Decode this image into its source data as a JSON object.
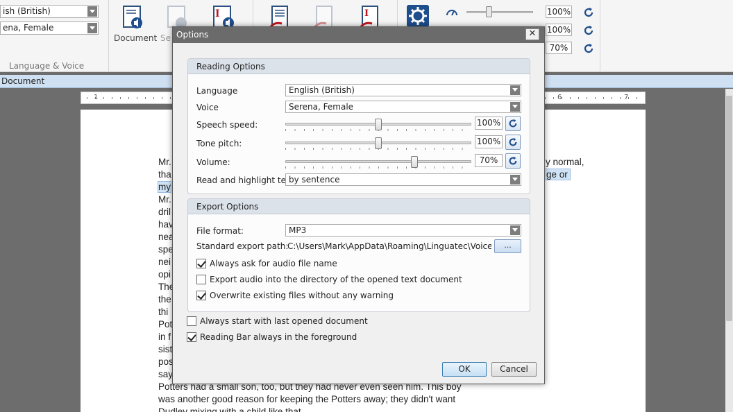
{
  "ribbon": {
    "language_value": "ish (British)",
    "voice_value": "ena, Female",
    "group_language_voice": "Language & Voice",
    "document_button": "Document",
    "second_button_partial": "Se",
    "speed_value": "100%",
    "pitch_value": "100%",
    "volume_value": "70%"
  },
  "doc_tab": "Document",
  "ruler": {
    "left_num": "1",
    "right_num1": "6",
    "right_num2": "7"
  },
  "document": {
    "lines_left": [
      "Mr.",
      "tha",
      "my",
      "Mr.",
      "dril",
      "hav",
      "nea",
      "spe",
      "nei",
      "opi",
      "The",
      "the",
      "thi",
      "Pot",
      "in f",
      "sist",
      "pos",
      "say"
    ],
    "line_right_1": "y normal,",
    "line_right_2": "ge or",
    "bottom_line_1": "Potters had a small son, too, but they had never even seen him. This boy",
    "bottom_line_2": "was another good reason for keeping the Potters away; they didn't want",
    "bottom_line_3": "Dudley mixing with a child like that."
  },
  "dialog": {
    "title": "Options",
    "close_label": "✕",
    "reading": {
      "header": "Reading Options",
      "language_label": "Language",
      "language_value": "English (British)",
      "voice_label": "Voice",
      "voice_value": "Serena, Female",
      "speed_label": "Speech speed:",
      "speed_value": "100%",
      "speed_level": 0.5,
      "pitch_label": "Tone pitch:",
      "pitch_value": "100%",
      "pitch_level": 0.5,
      "volume_label": "Volume:",
      "volume_value": "70%",
      "volume_level": 0.7,
      "highlight_label": "Read and highlight text",
      "highlight_value": "by sentence"
    },
    "export": {
      "header": "Export Options",
      "format_label": "File format:",
      "format_value": "MP3",
      "path_label": "Standard export path:",
      "path_value": "C:\\Users\\Mark\\AppData\\Roaming\\Linguatec\\VoiceRe...",
      "browse_label": "...",
      "ask_name_label": "Always ask for audio file name",
      "ask_name_checked": true,
      "export_dir_label": "Export audio into the directory of the opened text document",
      "export_dir_checked": false,
      "overwrite_label": "Overwrite existing files without any warning",
      "overwrite_checked": true
    },
    "start_last_label": "Always start with last opened document",
    "start_last_checked": false,
    "reading_bar_label": "Reading Bar always in the foreground",
    "reading_bar_checked": true,
    "ok_label": "OK",
    "cancel_label": "Cancel"
  },
  "colors": {
    "titlebar": "#6b6b6b",
    "accent": "#1f4e8c",
    "highlight": "#cfe3f7"
  }
}
